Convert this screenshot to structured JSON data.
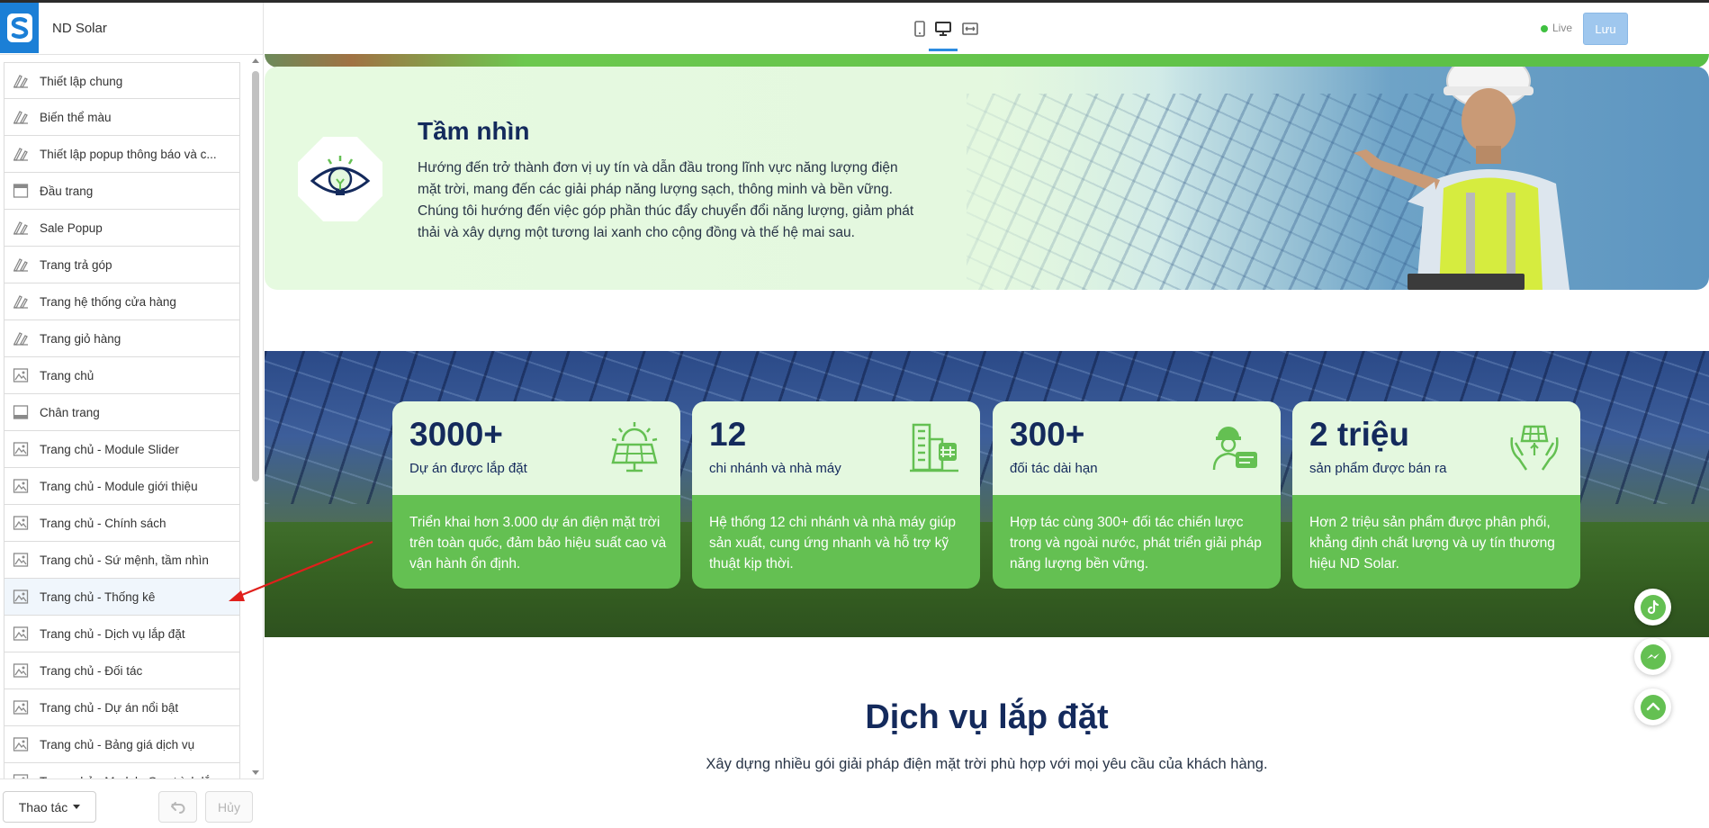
{
  "app": {
    "store_name": "ND Solar",
    "live_label": "Live",
    "save_label": "Lưu"
  },
  "sidebar": {
    "items": [
      {
        "label": "Thiết lập chung",
        "icon": "brush-icon"
      },
      {
        "label": "Biến thể màu",
        "icon": "brush-icon"
      },
      {
        "label": "Thiết lập popup thông báo và c...",
        "icon": "brush-icon"
      },
      {
        "label": "Đầu trang",
        "icon": "header-layout-icon"
      },
      {
        "label": "Sale Popup",
        "icon": "brush-icon"
      },
      {
        "label": "Trang trả góp",
        "icon": "brush-icon"
      },
      {
        "label": "Trang hệ thống cửa hàng",
        "icon": "brush-icon"
      },
      {
        "label": "Trang giỏ hàng",
        "icon": "brush-icon"
      },
      {
        "label": "Trang chủ",
        "icon": "image-section-icon"
      },
      {
        "label": "Chân trang",
        "icon": "footer-layout-icon"
      },
      {
        "label": "Trang chủ - Module Slider",
        "icon": "image-section-icon"
      },
      {
        "label": "Trang chủ - Module giới thiệu",
        "icon": "image-section-icon"
      },
      {
        "label": "Trang chủ - Chính sách",
        "icon": "image-section-icon"
      },
      {
        "label": "Trang chủ - Sứ mệnh, tầm nhìn",
        "icon": "image-section-icon"
      },
      {
        "label": "Trang chủ - Thống kê",
        "icon": "image-section-icon"
      },
      {
        "label": "Trang chủ - Dịch vụ lắp đặt",
        "icon": "image-section-icon"
      },
      {
        "label": "Trang chủ - Đối tác",
        "icon": "image-section-icon"
      },
      {
        "label": "Trang chủ - Dự án nổi bật",
        "icon": "image-section-icon"
      },
      {
        "label": "Trang chủ - Bảng giá dịch vụ",
        "icon": "image-section-icon"
      },
      {
        "label": "Trang chủ - Module Quy trình lắp",
        "icon": "image-section-icon"
      }
    ],
    "active_index": 14,
    "actions_label": "Thao tác",
    "cancel_label": "Hủy"
  },
  "toolbar": {
    "devices": [
      "mobile-device-icon",
      "desktop-device-icon",
      "fullwidth-device-icon"
    ],
    "active_device": "desktop-device-icon"
  },
  "preview": {
    "vision": {
      "title": "Tầm nhìn",
      "text": "Hướng đến trở thành đơn vị uy tín và dẫn đầu trong lĩnh vực năng lượng điện mặt trời, mang đến các giải pháp năng lượng sạch, thông minh và bền vững. Chúng tôi hướng đến việc góp phần thúc đẩy chuyển đổi năng lượng, giảm phát thải và xây dựng một tương lai xanh cho cộng đồng và thế hệ mai sau.",
      "icon": "eye-lightbulb-icon"
    },
    "stats": [
      {
        "number": "3000+",
        "label": "Dự án được lắp đặt",
        "desc": "Triển khai hơn 3.000 dự án điện mặt trời trên toàn quốc, đảm bảo hiệu suất cao và vận hành ổn định.",
        "icon": "solar-panel-sun-icon"
      },
      {
        "number": "12",
        "label": "chi nhánh và nhà máy",
        "desc": "Hệ thống 12 chi nhánh và nhà máy giúp sản xuất, cung ứng nhanh và hỗ trợ kỹ thuật kịp thời.",
        "icon": "buildings-icon"
      },
      {
        "number": "300+",
        "label": "đối tác dài hạn",
        "desc": "Hợp tác cùng 300+ đối tác chiến lược trong và ngoài nước, phát triển giải pháp năng lượng bền vững.",
        "icon": "worker-partner-icon"
      },
      {
        "number": "2 triệu",
        "label": "sản phẩm được bán ra",
        "desc": "Hơn 2 triệu sản phẩm được phân phối, khẳng định chất lượng và uy tín thương hiệu ND Solar.",
        "icon": "hands-solar-panel-icon"
      }
    ],
    "services": {
      "title": "Dịch vụ lắp đặt",
      "subtitle": "Xây dựng nhiều gói giải pháp điện mặt trời phù hợp với mọi yêu cầu của khách hàng."
    },
    "floating": [
      "tiktok-icon",
      "messenger-icon",
      "scroll-top-icon"
    ]
  },
  "colors": {
    "brand_navy": "#142a5c",
    "brand_green": "#64c052",
    "card_light": "#e4f8df",
    "accent_blue": "#2a8be0",
    "live_green": "#3fc040"
  }
}
